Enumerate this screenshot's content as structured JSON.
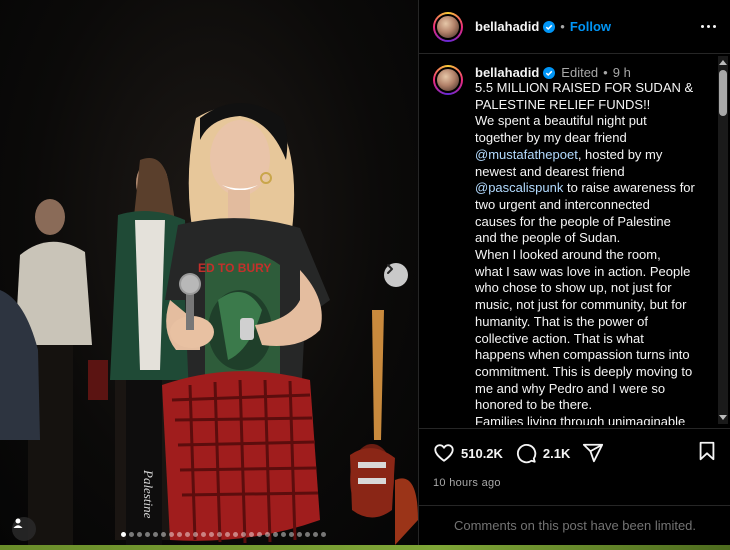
{
  "post": {
    "username": "bellahadid",
    "follow_label": "Follow",
    "separator": "•",
    "edited_label": "Edited",
    "time_ago_short": "9 h",
    "caption_lines": [
      {
        "text": "5.5 MILLION RAISED FOR SUDAN &"
      },
      {
        "text": "PALESTINE RELIEF FUNDS!!"
      },
      {
        "text": "We spent a beautiful night put"
      },
      {
        "text": "together by my dear friend"
      },
      {
        "mention": "@mustafathepoet",
        "text": ", hosted by my"
      },
      {
        "text": "newest and dearest friend"
      },
      {
        "mention": "@pascalispunk",
        "text": " to raise awareness for"
      },
      {
        "text": "two urgent and interconnected"
      },
      {
        "text": "causes for the people of Palestine"
      },
      {
        "text": "and the people of Sudan."
      },
      {
        "text": "When I looked around the room,"
      },
      {
        "text": "what I saw was love in action. People"
      },
      {
        "text": "who chose to show up, not just for"
      },
      {
        "text": "music, not just for community, but for"
      },
      {
        "text": "humanity. That is the power of"
      },
      {
        "text": "collective action. That is what"
      },
      {
        "text": "happens when compassion turns into"
      },
      {
        "text": "commitment. This is deeply moving to"
      },
      {
        "text": "me and why Pedro and I were so"
      },
      {
        "text": "honored to be there."
      },
      {
        "text": "Families living through unimaginable"
      }
    ],
    "likes": "510.2K",
    "comments_count": "2.1K",
    "posted_ago": "10 hours ago",
    "comments_limited": "Comments on this post have been limited."
  },
  "carousel": {
    "total_dots": 26,
    "active_index": 0
  },
  "photo": {
    "tshirt_text": "ED TO BURY",
    "pants_text": "Palestine"
  },
  "icons": {
    "more": "more-options-icon",
    "like": "heart-icon",
    "comment": "comment-icon",
    "share": "share-icon",
    "save": "bookmark-icon",
    "next": "chevron-right-icon",
    "tagged": "user-tag-icon",
    "verified": "verified-badge-icon"
  },
  "colors": {
    "link": "#0095f6",
    "mention": "#b3dbff",
    "muted": "#a8a8a8"
  }
}
